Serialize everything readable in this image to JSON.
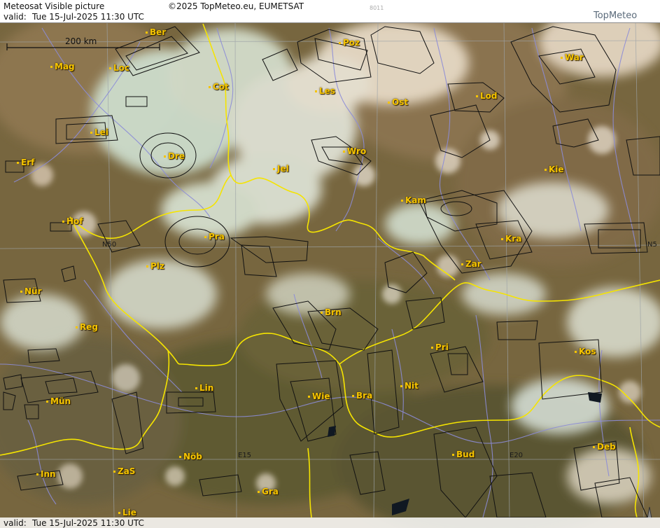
{
  "header": {
    "title": "Meteosat Visible picture",
    "copyright": "©2025 TopMeteo.eu, EUMETSAT",
    "code": "8011",
    "valid_label": "valid:",
    "valid_time": "Tue  15-Jul-2025  11:30 UTC",
    "logo": "TopMeteo"
  },
  "footer": {
    "valid_label": "valid:",
    "valid_time": "Tue  15-Jul-2025  11:30 UTC"
  },
  "scale": {
    "label": "200 km"
  },
  "grid_labels": {
    "n50_left": "N50",
    "n50_right": "N5",
    "e15": "E15",
    "e20": "E20"
  },
  "cities": {
    "ber": "Ber",
    "mag": "Mag",
    "loc": "Loc",
    "cot": "Cot",
    "poz": "Poz",
    "war": "War",
    "les": "Les",
    "ost": "Ost",
    "lod": "Lod",
    "lei": "Lei",
    "dre": "Dre",
    "wro": "Wro",
    "erf": "Erf",
    "jel": "Jel",
    "kie": "Kie",
    "kam": "Kam",
    "hof": "Hof",
    "pra": "Pra",
    "kra": "Kra",
    "plz": "Plz",
    "zar": "Zar",
    "nur": "Nür",
    "brn": "Brn",
    "reg": "Reg",
    "pri": "Pri",
    "kos": "Kos",
    "nit": "Nit",
    "lin": "Lin",
    "mun": "Mün",
    "wie": "Wie",
    "bra": "Bra",
    "bud": "Bud",
    "deb": "Deb",
    "nob": "Nöb",
    "inn": "Inn",
    "zas": "ZaS",
    "gra": "Gra",
    "lie": "Lie"
  },
  "colors": {
    "border": "#f5e400",
    "airspace": "#111111",
    "river": "#8c8cd8",
    "city": "#f5c400",
    "land": "#7a6a48",
    "cloud": "#dfe3d6"
  }
}
